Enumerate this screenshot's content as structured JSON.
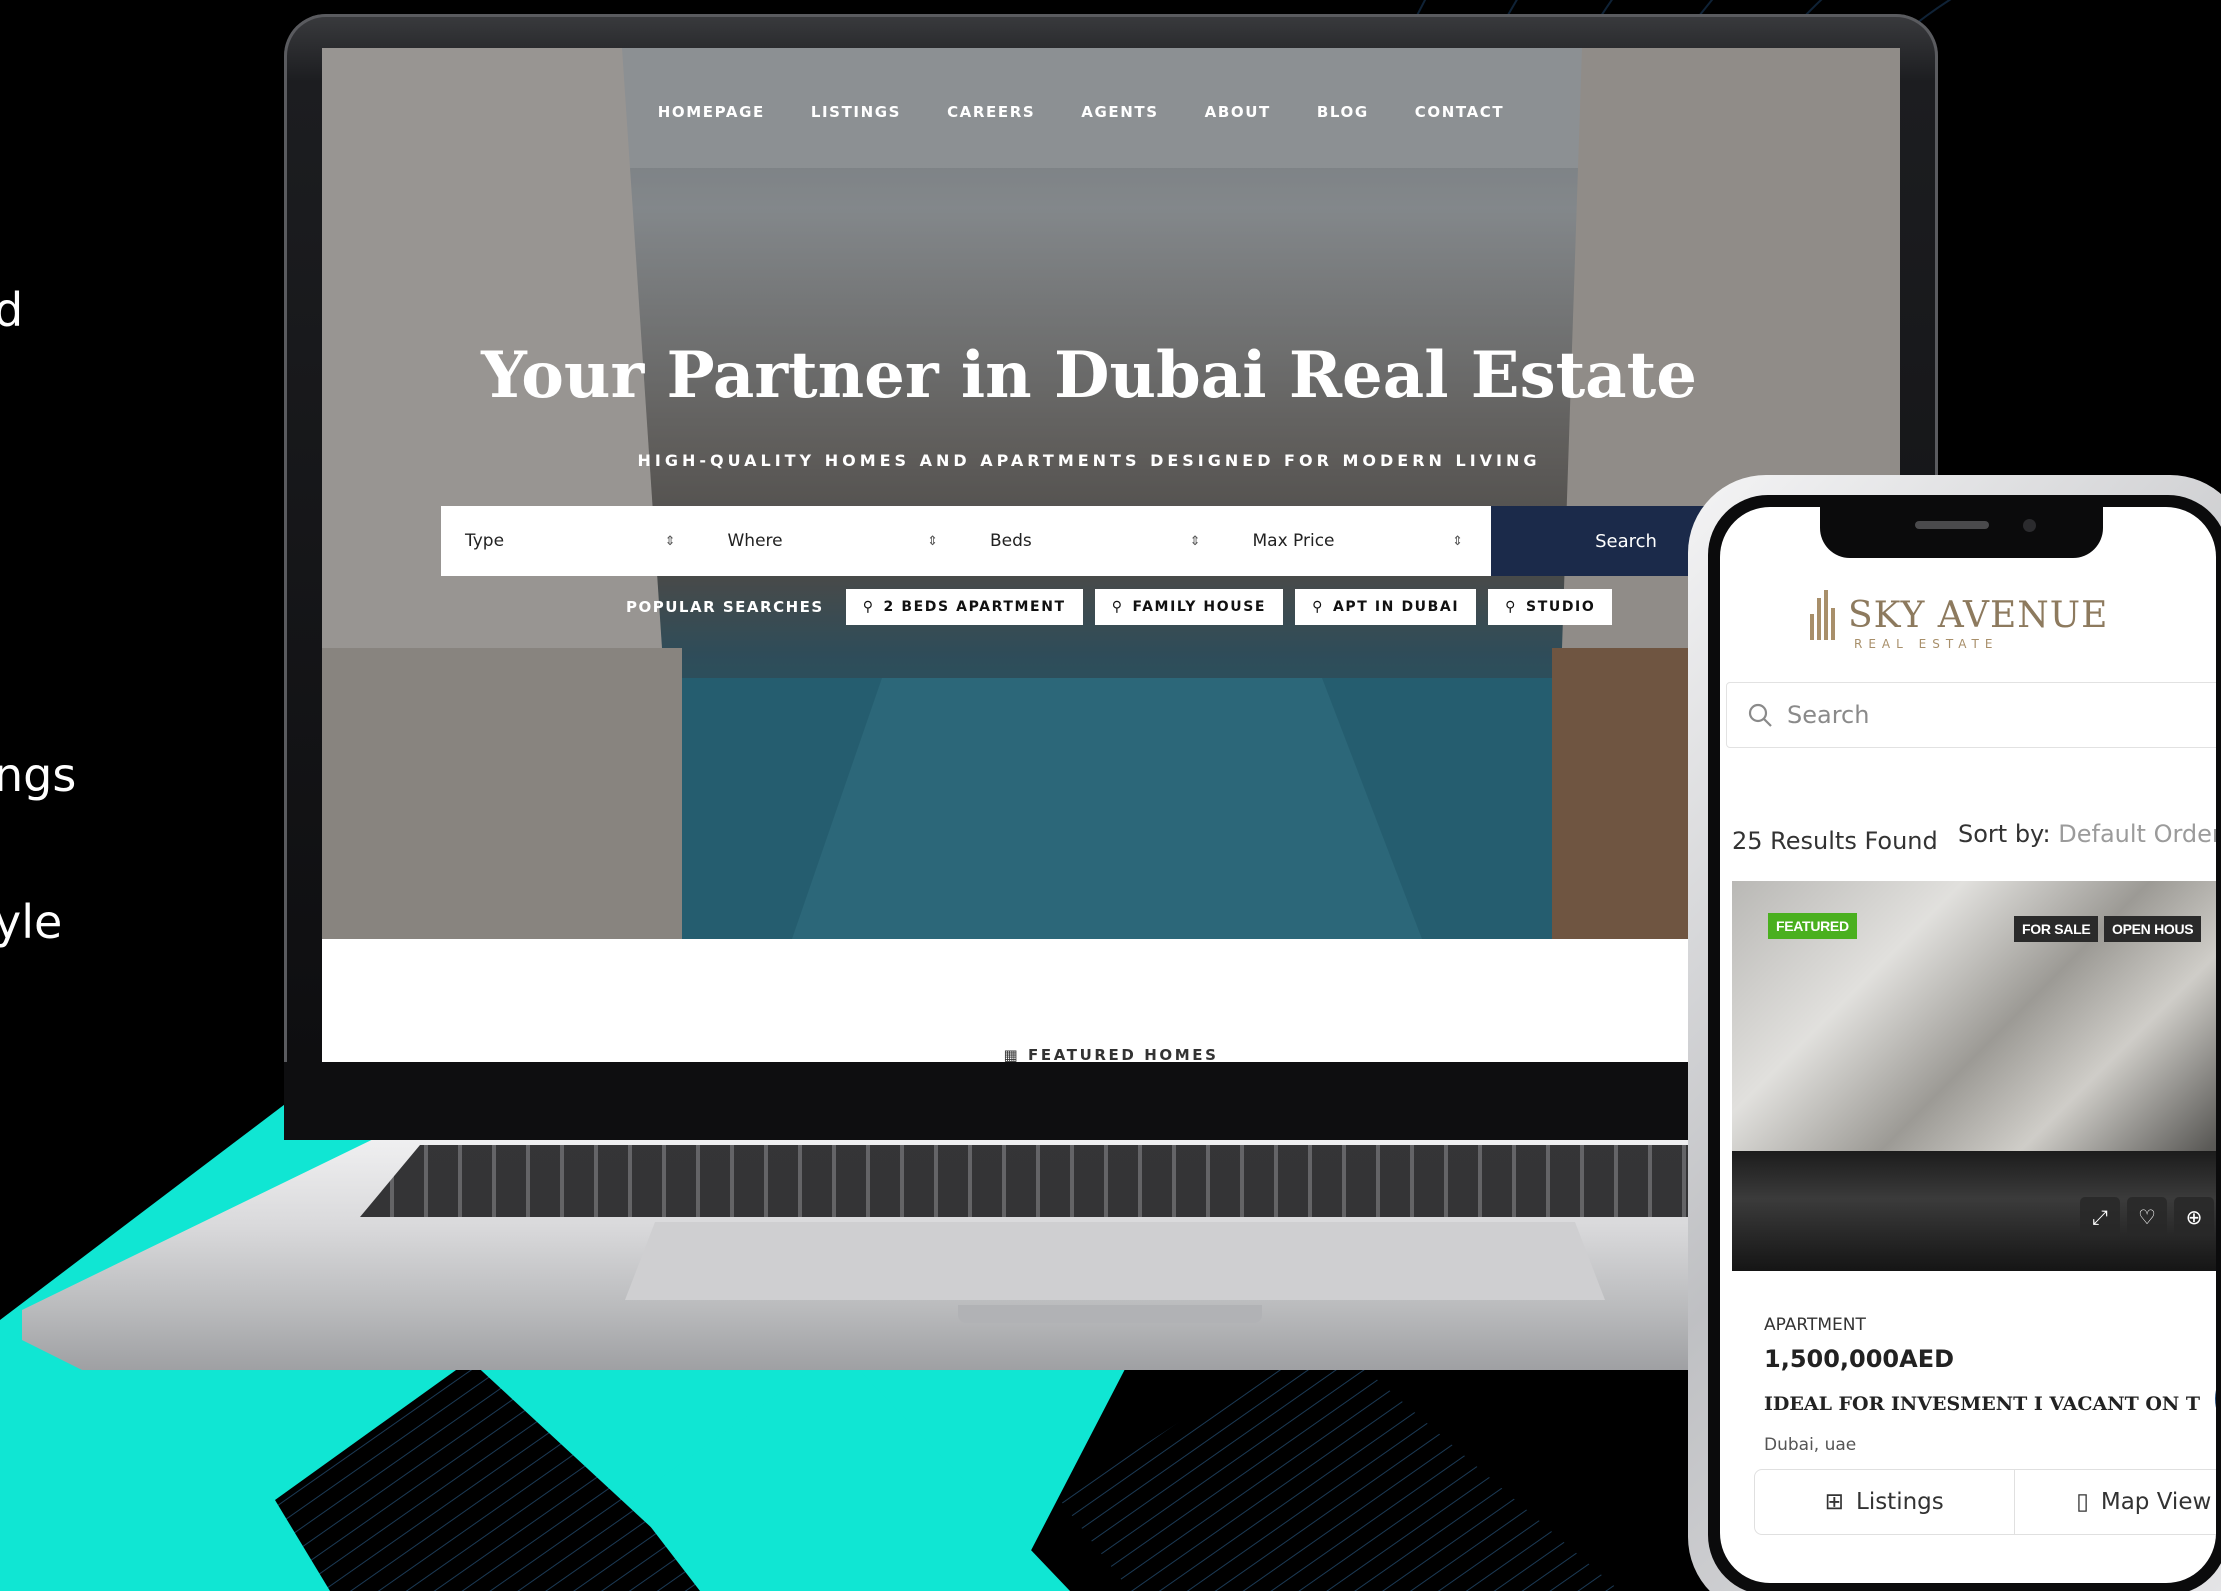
{
  "side_texts": [
    "d",
    "ngs",
    "yle"
  ],
  "colors": {
    "accent_teal": "#10e6d3",
    "navy": "#1b2a4a",
    "featured_green": "#4ab01f",
    "gold": "#a88f6a"
  },
  "laptop_site": {
    "nav": [
      "HOMEPAGE",
      "LISTINGS",
      "CAREERS",
      "AGENTS",
      "ABOUT",
      "BLOG",
      "CONTACT"
    ],
    "hero_title": "Your Partner in Dubai Real Estate",
    "hero_subtitle": "HIGH-QUALITY HOMES AND APARTMENTS DESIGNED FOR MODERN LIVING",
    "search_fields": [
      "Type",
      "Where",
      "Beds",
      "Max Price"
    ],
    "search_button": "Search",
    "popular_label": "POPULAR SEARCHES",
    "popular_chips": [
      "2 BEDS APARTMENT",
      "FAMILY HOUSE",
      "APT IN DUBAI",
      "STUDIO"
    ],
    "featured_heading": "FEATURED HOMES"
  },
  "phone_app": {
    "logo_name": "SKY AVENUE",
    "logo_sub": "REAL ESTATE",
    "search_placeholder": "Search",
    "results": "25 Results Found",
    "sort_label": "Sort by:",
    "sort_value": "Default Order",
    "card": {
      "badge_featured": "FEATURED",
      "badge_sale": "FOR SALE",
      "badge_open": "OPEN HOUS",
      "type": "APARTMENT",
      "price": "1,500,000AED",
      "title": "IDEAL FOR INVESMENT I VACANT ON T",
      "location": "Dubai, uae"
    },
    "tabs": {
      "listings": "Listings",
      "map": "Map View"
    }
  }
}
